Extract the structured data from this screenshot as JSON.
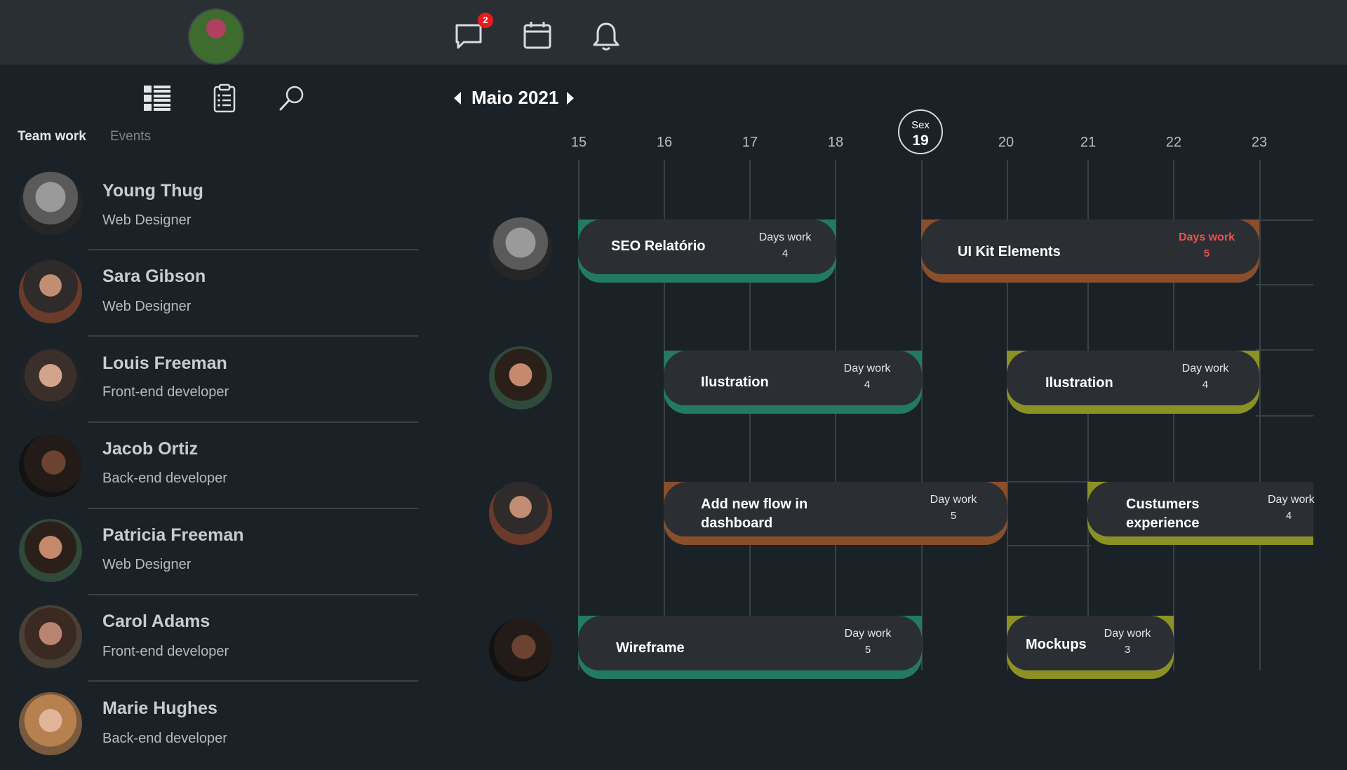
{
  "topbar": {
    "message_badge": "2",
    "icons": [
      "chat-bubble-icon",
      "calendar-icon",
      "bell-icon"
    ]
  },
  "sidebar": {
    "icons": [
      "list-view-icon",
      "clipboard-icon",
      "search-icon"
    ],
    "tabs": [
      {
        "label": "Team work",
        "active": true
      },
      {
        "label": "Events",
        "active": false
      }
    ],
    "members": [
      {
        "name": "Young Thug",
        "role": "Web Designer"
      },
      {
        "name": "Sara Gibson",
        "role": "Web Designer"
      },
      {
        "name": "Louis Freeman",
        "role": "Front-end developer"
      },
      {
        "name": "Jacob Ortiz",
        "role": "Back-end developer"
      },
      {
        "name": "Patricia Freeman",
        "role": "Web Designer"
      },
      {
        "name": "Carol Adams",
        "role": "Front-end developer"
      },
      {
        "name": "Marie Hughes",
        "role": "Back-end developer"
      }
    ]
  },
  "calendar": {
    "month_label": "Maio 2021",
    "days": [
      "15",
      "16",
      "17",
      "18",
      "19",
      "20",
      "21",
      "22",
      "23"
    ],
    "today": {
      "weekday": "Sex",
      "day": "19"
    },
    "tasks": [
      {
        "title": "SEO Relatório",
        "dw_label": "Days work",
        "dw_value": "4",
        "color": "#237a63"
      },
      {
        "title": "UI Kit Elements",
        "dw_label": "Days work",
        "dw_value": "5",
        "color": "#8a4e2b",
        "dw_color": "#f0524b"
      },
      {
        "title": "Ilustration",
        "dw_label": "Day work",
        "dw_value": "4",
        "color": "#237a63"
      },
      {
        "title": "Ilustration",
        "dw_label": "Day work",
        "dw_value": "4",
        "color": "#8c9126"
      },
      {
        "title": "Add new flow in dashboard",
        "dw_label": "Day work",
        "dw_value": "5",
        "color": "#8a4e2b"
      },
      {
        "title": "Custumers experience",
        "dw_label": "Day work",
        "dw_value": "4",
        "color": "#8c9126"
      },
      {
        "title": "Wireframe",
        "dw_label": "Day work",
        "dw_value": "5",
        "color": "#237a63"
      },
      {
        "title": "Mockups",
        "dw_label": "Day work",
        "dw_value": "3",
        "color": "#8c9126"
      }
    ]
  },
  "colors": {
    "background": "#1b2227",
    "topbar": "#2a2f33",
    "card": "#2b2f33",
    "accent_green": "#237a63",
    "accent_brown": "#8a4e2b",
    "accent_olive": "#8c9126",
    "badge_red": "#e81c1c"
  }
}
